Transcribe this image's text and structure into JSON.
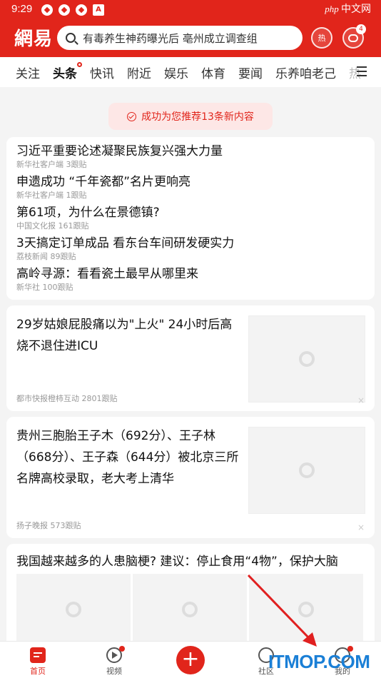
{
  "status": {
    "time": "9:29",
    "right_logo": "php",
    "right_text": "中文网"
  },
  "header": {
    "logo": "網易",
    "search_placeholder": "有毒养生神药曝光后 亳州成立调查组",
    "hot_label": "热",
    "msg_count": "4"
  },
  "tabs": [
    "关注",
    "头条",
    "快讯",
    "附近",
    "娱乐",
    "体育",
    "要闻",
    "乐养咱老己",
    "热"
  ],
  "toast": "成功为您推荐13条新内容",
  "topics": [
    {
      "title": "习近平重要论述凝聚民族复兴强大力量",
      "source": "新华社客户端",
      "count": "3跟贴"
    },
    {
      "title": "申遗成功 “千年瓷都”名片更响亮",
      "source": "新华社客户端",
      "count": "1跟贴"
    },
    {
      "title": "第61项，为什么在景德镇?",
      "source": "中国文化报",
      "count": "161跟贴"
    },
    {
      "title": "3天搞定订单成品 看东台车间研发硬实力",
      "source": "荔枝新闻",
      "count": "89跟贴"
    },
    {
      "title": "高岭寻源：看看瓷土最早从哪里来",
      "source": "新华社",
      "count": "100跟贴"
    }
  ],
  "news1": {
    "title": "29岁姑娘屁股痛以为\"上火\" 24小时后高烧不退住进ICU",
    "meta": "都市快报橙柿互动  2801跟贴",
    "close": "×"
  },
  "news2": {
    "title": "贵州三胞胎王子木（692分）、王子林（668分）、王子森（644分）被北京三所名牌高校录取，老大考上清华",
    "meta": "扬子晚报  573跟贴",
    "close": "×"
  },
  "news3": {
    "title": "我国越来越多的人患脑梗? 建议：停止食用“4物”，保护大脑"
  },
  "bottom": {
    "home": "首页",
    "video": "视频",
    "plus": "+",
    "community": "社区",
    "mine": "我的"
  },
  "watermark": "ITMOP.COM",
  "colors": {
    "brand": "#e1251b",
    "arrow": "#e02020",
    "watermark": "#1a7fd6"
  }
}
